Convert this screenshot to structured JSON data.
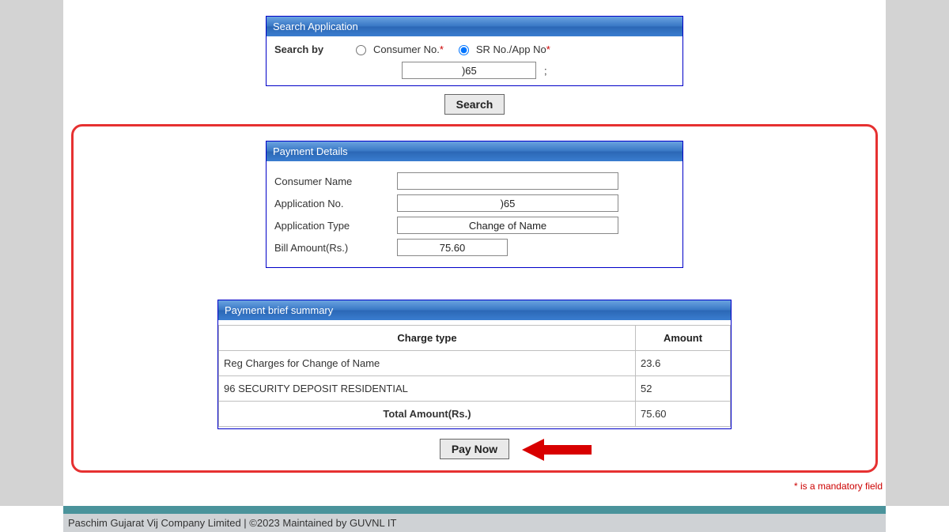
{
  "search_panel": {
    "title": "Search Application",
    "search_by_label": "Search by",
    "option_consumer": "Consumer No.",
    "option_sr": "SR No./App No",
    "star": "*",
    "input_value": ")65",
    "separator": ";",
    "search_button": "Search"
  },
  "details_panel": {
    "title": "Payment Details",
    "consumer_name_label": "Consumer Name",
    "consumer_name_value": "",
    "app_no_label": "Application No.",
    "app_no_value": ")65",
    "app_type_label": "Application Type",
    "app_type_value": "Change of Name",
    "bill_amount_label": "Bill Amount(Rs.)",
    "bill_amount_value": "75.60"
  },
  "summary_panel": {
    "title": "Payment brief summary",
    "col_charge": "Charge type",
    "col_amount": "Amount",
    "rows": [
      {
        "charge": "Reg Charges for Change of Name",
        "amount": "23.6"
      },
      {
        "charge": "96 SECURITY DEPOSIT RESIDENTIAL",
        "amount": "52"
      }
    ],
    "total_label": "Total Amount(Rs.)",
    "total_value": "75.60",
    "pay_now_button": "Pay Now"
  },
  "mandatory_text": "* is a mandatory field",
  "footer_text": "Paschim Gujarat Vij Company Limited | ©2023 Maintained by GUVNL IT"
}
